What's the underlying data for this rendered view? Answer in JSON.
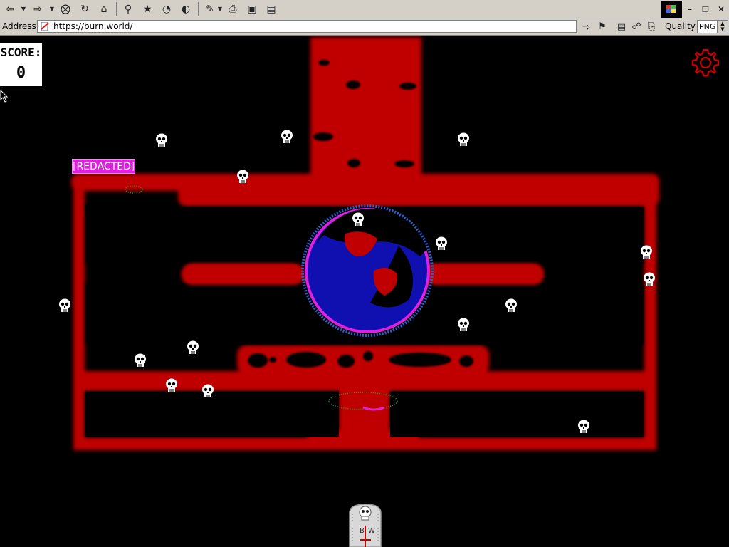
{
  "browser": {
    "address_label": "Address",
    "url": "https://burn.world/",
    "quality_label": "Quality",
    "quality_value": "PNG",
    "toolbar_icons": [
      "back-icon",
      "forward-icon",
      "stop-icon",
      "refresh-icon",
      "home-icon",
      "search-icon",
      "favorites-icon",
      "history-icon",
      "channels-icon",
      "edit-icon",
      "print-icon",
      "fullscreen-icon",
      "page-icon"
    ],
    "window_controls": [
      "windows-logo-icon",
      "minimize-icon",
      "restore-icon",
      "close-icon"
    ]
  },
  "hud": {
    "score_label": "SCORE:",
    "score_value": "0",
    "player_name": "[REDACTED]",
    "settings_icon": "gear-icon"
  },
  "gravestone": {
    "letters": [
      "B",
      "W"
    ]
  },
  "colors": {
    "blood": "#c00000",
    "planet": "#1010b0",
    "accent": "#e020e0",
    "background": "#000000"
  }
}
